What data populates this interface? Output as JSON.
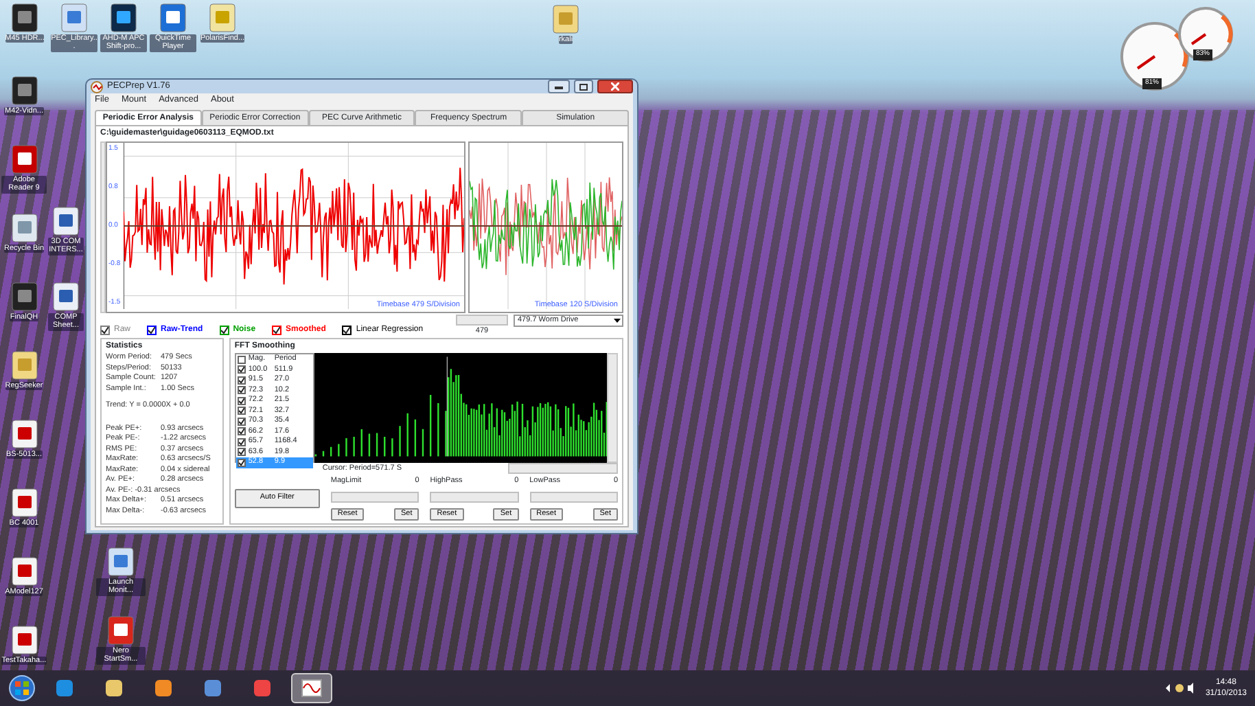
{
  "desktop": {
    "top_icons": [
      {
        "label": "M45 HDR...",
        "kind": "photo"
      },
      {
        "label": "PEC_Library...",
        "kind": "app"
      },
      {
        "label": "AHD-M APC Shift-pro...",
        "kind": "ps"
      },
      {
        "label": "QuickTime Player",
        "kind": "qt"
      },
      {
        "label": "PolarisFind...",
        "kind": "file"
      }
    ],
    "left_icons": [
      {
        "label": "M42-Vidn...",
        "kind": "photo"
      },
      {
        "label": "Adobe Reader 9",
        "kind": "pdf"
      },
      {
        "label": "Recycle Bin",
        "kind": "bin"
      },
      {
        "label": "FinalQH",
        "kind": "photo"
      },
      {
        "label": "RegSeeker",
        "kind": "folder"
      },
      {
        "label": "BS-5013...",
        "kind": "doc"
      },
      {
        "label": "BC 4001",
        "kind": "doc"
      },
      {
        "label": "AModel127",
        "kind": "doc"
      },
      {
        "label": "TestTakaha...",
        "kind": "doc"
      }
    ],
    "second_icons": [
      {
        "label": "3D COM INTERS...",
        "kind": "word"
      },
      {
        "label": "COMP Sheet...",
        "kind": "word"
      },
      {
        "label": "Launch Monit...",
        "kind": "app"
      },
      {
        "label": "Nero StartSm...",
        "kind": "nero"
      }
    ],
    "folder": {
      "label": "rkali"
    },
    "gauges": [
      {
        "reading": "81%"
      },
      {
        "reading": "83%"
      }
    ]
  },
  "window": {
    "title": "PECPrep V1.76",
    "menu": [
      "File",
      "Mount",
      "Advanced",
      "About"
    ],
    "tabs": [
      {
        "label": "Periodic Error Analysis",
        "selected": true
      },
      {
        "label": "Periodic Error Correction",
        "selected": false
      },
      {
        "label": "PEC Curve Arithmetic",
        "selected": false
      },
      {
        "label": "Frequency Spectrum",
        "selected": false
      },
      {
        "label": "Simulation",
        "selected": false
      }
    ],
    "file_path": "C:\\guidemaster\\guidage0603113_EQMOD.txt",
    "y_ticks": [
      "1.5",
      "0.8",
      "0.0",
      "-0.8",
      "-1.5"
    ],
    "main_timebase": "Timebase 479 S/Division",
    "side_timebase": "Timebase 120 S/Division",
    "scroll_value": "479",
    "drive_select": "479.7 Worm Drive",
    "series_toggles": [
      {
        "label": "Raw",
        "checked": true,
        "color": "#808080"
      },
      {
        "label": "Raw-Trend",
        "checked": true,
        "color": "#0000ff"
      },
      {
        "label": "Noise",
        "checked": true,
        "color": "#00a000"
      },
      {
        "label": "Smoothed",
        "checked": true,
        "color": "#ff0000"
      },
      {
        "label": "Linear Regression",
        "checked": true,
        "color": "#000000"
      }
    ],
    "statistics": {
      "title": "Statistics",
      "top_rows": [
        {
          "label": "Worm Period:",
          "value": "479 Secs"
        },
        {
          "label": "Steps/Period:",
          "value": "50133"
        },
        {
          "label": "Sample Count:",
          "value": "1207"
        },
        {
          "label": "Sample Int.:",
          "value": "1.00 Secs"
        }
      ],
      "trend": "Trend: Y = 0.0000X + 0.0",
      "rows": [
        {
          "label": "Peak PE+:",
          "value": "0.93 arcsecs"
        },
        {
          "label": "Peak PE-:",
          "value": "-1.22 arcsecs"
        },
        {
          "label": "RMS PE:",
          "value": "0.37 arcsecs"
        },
        {
          "label": "MaxRate:",
          "value": "0.63 arcsecs/S"
        },
        {
          "label": "MaxRate:",
          "value": "0.04 x sidereal"
        },
        {
          "label": "Av. PE+:",
          "value": "0.28 arcsecs"
        }
      ],
      "av_minus": "Av. PE-:  -0.31 arcsecs",
      "delta_rows": [
        {
          "label": "Max Delta+:",
          "value": "0.51 arcsecs"
        },
        {
          "label": "Max Delta-:",
          "value": "-0.63 arcsecs"
        }
      ]
    },
    "fft": {
      "title": "FFT Smoothing",
      "header": {
        "checked": false,
        "mag": "Mag.",
        "period": "Period"
      },
      "rows": [
        {
          "mag": "100.0",
          "period": "511.9",
          "checked": true,
          "selected": false
        },
        {
          "mag": "91.5",
          "period": "27.0",
          "checked": true,
          "selected": false
        },
        {
          "mag": "72.3",
          "period": "10.2",
          "checked": true,
          "selected": false
        },
        {
          "mag": "72.2",
          "period": "21.5",
          "checked": true,
          "selected": false
        },
        {
          "mag": "72.1",
          "period": "32.7",
          "checked": true,
          "selected": false
        },
        {
          "mag": "70.3",
          "period": "35.4",
          "checked": true,
          "selected": false
        },
        {
          "mag": "66.2",
          "period": "17.6",
          "checked": true,
          "selected": false
        },
        {
          "mag": "65.7",
          "period": "1168.4",
          "checked": true,
          "selected": false
        },
        {
          "mag": "63.6",
          "period": "19.8",
          "checked": true,
          "selected": false
        },
        {
          "mag": "52.8",
          "period": "9.9",
          "checked": true,
          "selected": true
        }
      ],
      "cursor": "Cursor: Period=571.7 S",
      "auto_filter": "Auto Filter",
      "sliders": [
        {
          "label": "MagLimit",
          "value": "0",
          "reset": "Reset",
          "set": "Set"
        },
        {
          "label": "HighPass",
          "value": "0",
          "reset": "Reset",
          "set": "Set"
        },
        {
          "label": "LowPass",
          "value": "0",
          "reset": "Reset",
          "set": "Set"
        }
      ]
    }
  },
  "taskbar": {
    "time": "14:48",
    "date": "31/10/2013"
  }
}
